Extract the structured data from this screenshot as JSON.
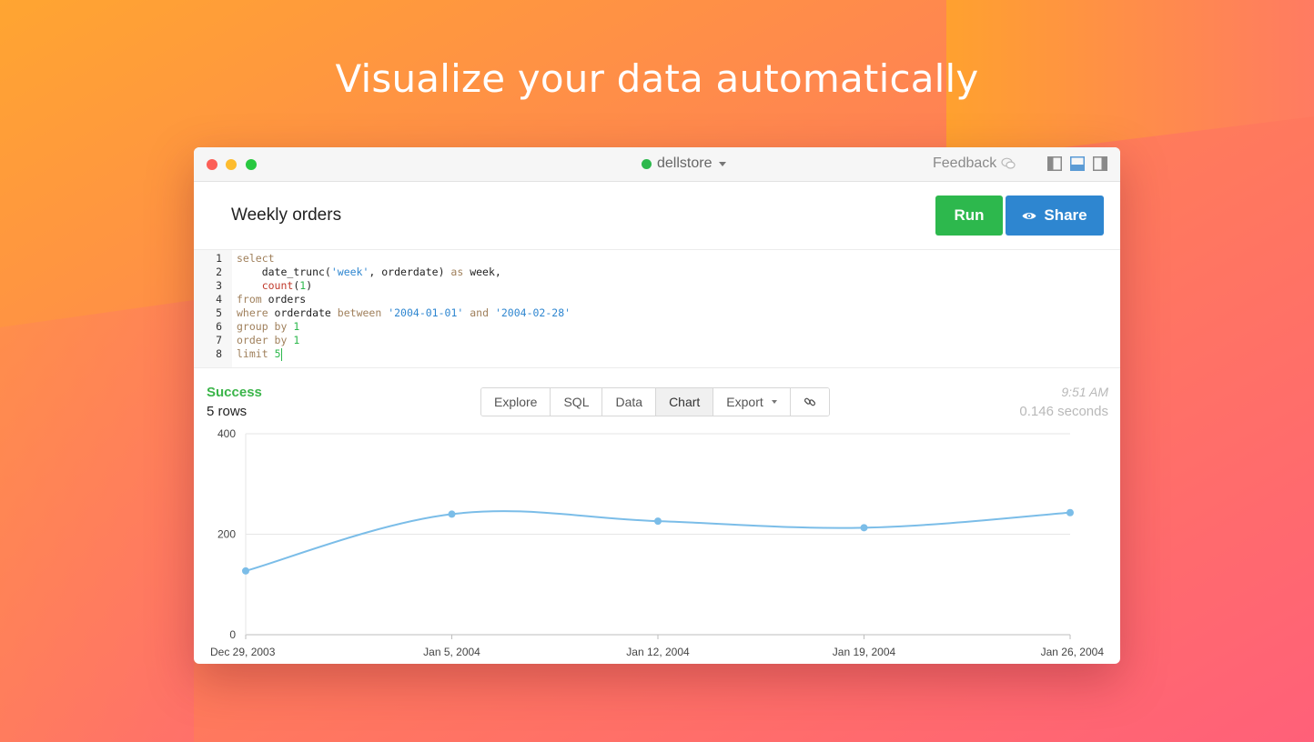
{
  "headline": "Visualize your data automatically",
  "colors": {
    "run": "#2db84d",
    "share": "#2e86d0",
    "success": "#3bb54a",
    "line": "#7bbde8"
  },
  "window": {
    "database": "dellstore",
    "feedback_label": "Feedback",
    "icons": [
      "feedback-bubble-icon",
      "layout-left-panel-icon",
      "layout-bottom-panel-icon",
      "layout-right-panel-icon",
      "eye-icon",
      "link-icon"
    ]
  },
  "query": {
    "title": "Weekly orders",
    "run_label": "Run",
    "share_label": "Share"
  },
  "editor": {
    "line_numbers": [
      "1",
      "2",
      "3",
      "4",
      "5",
      "6",
      "7",
      "8"
    ],
    "code_lines": [
      "select",
      "    date_trunc('week', orderdate) as week,",
      "    count(1)",
      "from orders",
      "where orderdate between '2004-01-01' and '2004-02-28'",
      "group by 1",
      "order by 1",
      "limit 5"
    ]
  },
  "results": {
    "status": "Success",
    "row_count": "5 rows",
    "time": "9:51 AM",
    "duration": "0.146 seconds",
    "tabs": [
      "Explore",
      "SQL",
      "Data",
      "Chart",
      "Export"
    ],
    "active_tab": "Chart"
  },
  "chart_data": {
    "type": "line",
    "categories": [
      "Dec 29, 2003",
      "Jan 5, 2004",
      "Jan 12, 2004",
      "Jan 19, 2004",
      "Jan 26, 2004"
    ],
    "values": [
      127,
      240,
      226,
      213,
      243
    ],
    "ylim": [
      0,
      400
    ],
    "yticks": [
      0,
      200,
      400
    ],
    "grid": true
  }
}
